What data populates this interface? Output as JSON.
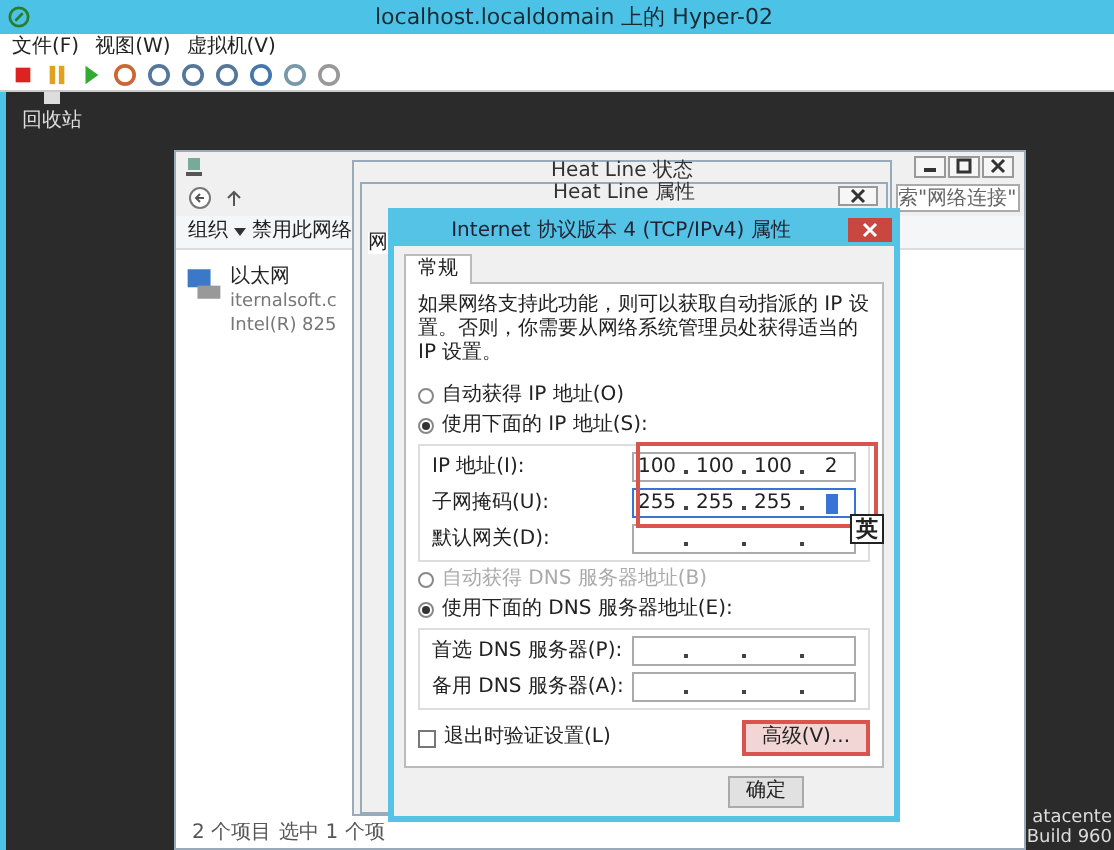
{
  "window": {
    "title": "localhost.localdomain 上的 Hyper-02"
  },
  "menu": [
    {
      "label": "文件(F)"
    },
    {
      "label": "视图(W)"
    },
    {
      "label": "虚拟机(V)"
    }
  ],
  "desktop": {
    "icon_label": "回收站",
    "edition_lines": [
      "atacente",
      "Build 960"
    ]
  },
  "explorer": {
    "search_placeholder": "索\"网络连接\"",
    "commands": [
      "组织",
      "禁用此网络"
    ],
    "items": [
      {
        "name": "以太网",
        "line_2": "iternalsoft.c",
        "line_3": "Intel(R) 825"
      }
    ],
    "status": [
      "2 个项目",
      "选中 1 个项"
    ]
  },
  "status_window": {
    "title": "Heat Line 状态"
  },
  "properties_window": {
    "title": "Heat Line 属性",
    "tab": "网"
  },
  "ipv4_dialog": {
    "title": "Internet 协议版本 4 (TCP/IPv4) 属性",
    "tabs": [
      {
        "label": "常规",
        "selected": true
      }
    ],
    "description": "如果网络支持此功能，则可以获取自动指派的 IP 设置。否则，你需要从网络系统管理员处获得适当的 IP 设置。",
    "ip_mode": [
      {
        "label": "自动获得 IP 地址(O)",
        "selected": false,
        "disabled": false
      },
      {
        "label": "使用下面的 IP 地址(S):",
        "selected": true,
        "disabled": false
      }
    ],
    "ip_fields": [
      {
        "label": "IP 地址(I):",
        "octets": [
          "100",
          "100",
          "100",
          "2"
        ],
        "cursor": false
      },
      {
        "label": "子网掩码(U):",
        "octets": [
          "255",
          "255",
          "255"
        ],
        "cursor": true
      },
      {
        "label": "默认网关(D):",
        "cursor": false
      }
    ],
    "ime_indicator": "英",
    "dns_mode": [
      {
        "label": "自动获得 DNS 服务器地址(B)",
        "selected": false,
        "disabled": true
      },
      {
        "label": "使用下面的 DNS 服务器地址(E):",
        "selected": true,
        "disabled": false
      }
    ],
    "dns_fields": [
      {
        "label": "首选 DNS 服务器(P):",
        "cursor": false
      },
      {
        "label": "备用 DNS 服务器(A):",
        "cursor": false
      }
    ],
    "validate": {
      "label": "退出时验证设置(L)",
      "checked": false
    },
    "advanced_button": "高级(V)...",
    "ok_button": "确定"
  }
}
